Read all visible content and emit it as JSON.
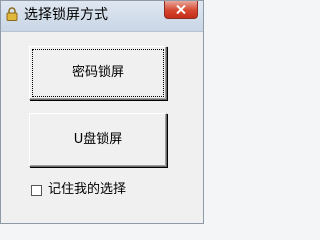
{
  "window": {
    "title": "选择锁屏方式"
  },
  "buttons": {
    "password_lock": "密码锁屏",
    "usb_lock": "U盘锁屏"
  },
  "remember": {
    "label": "记住我的选择",
    "checked": false
  },
  "icons": {
    "app": "lock-icon",
    "close": "close-icon"
  },
  "colors": {
    "close_button": "#d6462f",
    "titlebar": "#c9d6e5"
  }
}
